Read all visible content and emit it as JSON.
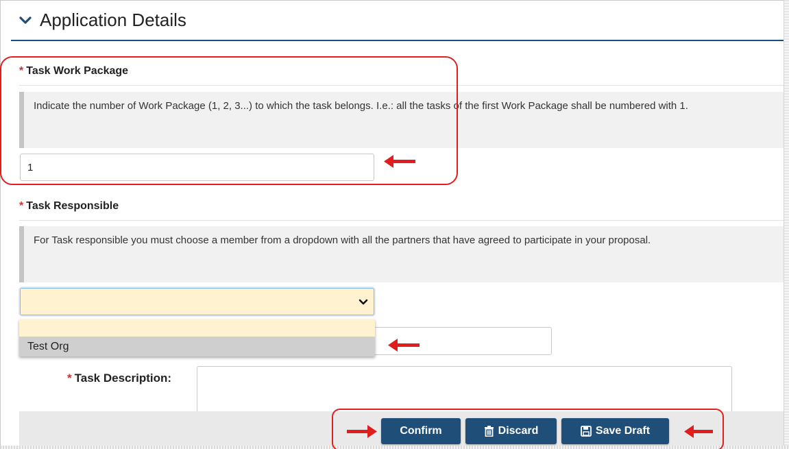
{
  "section": {
    "title": "Application Details"
  },
  "task_work_package": {
    "label": "Task Work Package",
    "required_mark": "*",
    "help_text": "Indicate the number of Work Package (1, 2, 3...) to which the task belongs. I.e.: all the tasks of the first Work Package shall be numbered with 1.",
    "value": "1"
  },
  "task_responsible": {
    "label": "Task Responsible",
    "required_mark": "*",
    "help_text": "For Task responsible you must choose a member from a dropdown with all the partners that have agreed to participate in your proposal.",
    "selected_value": "",
    "options": [
      "",
      "Test Org"
    ]
  },
  "task_description": {
    "label": "Task Description:",
    "required_mark": "*",
    "value": ""
  },
  "buttons": {
    "confirm": "Confirm",
    "discard": "Discard",
    "save_draft": "Save Draft"
  },
  "colors": {
    "primary": "#1f4e79",
    "required": "#d32f2f",
    "annotation": "#e01e1e",
    "select_bg": "#fff2d1"
  }
}
